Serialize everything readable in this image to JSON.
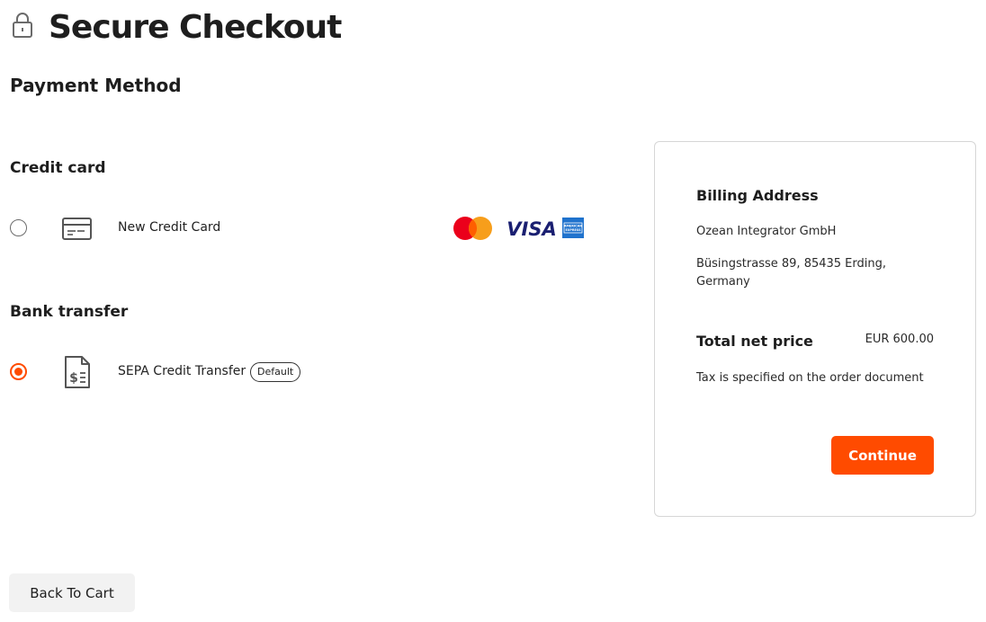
{
  "header": {
    "title": "Secure Checkout",
    "icon": "lock-icon"
  },
  "payment": {
    "section_title": "Payment Method",
    "credit_card": {
      "group_title": "Credit card",
      "option_label": "New Credit Card",
      "selected": false,
      "icon": "credit-card-icon",
      "brands": [
        "mastercard-logo",
        "visa-logo",
        "amex-logo"
      ],
      "visa_text": "VISA",
      "amex_text": "AMERICAN EXPRESS"
    },
    "bank_transfer": {
      "group_title": "Bank transfer",
      "option_label": "SEPA Credit Transfer",
      "badge": "Default",
      "selected": true,
      "icon": "invoice-document-icon"
    }
  },
  "summary": {
    "billing_title": "Billing Address",
    "company": "Ozean Integrator GmbH",
    "address": "Büsingstrasse 89, 85435 Erding, Germany",
    "total_label": "Total net price",
    "total_value": "EUR 600.00",
    "tax_note": "Tax is specified on the order document",
    "continue_label": "Continue"
  },
  "footer": {
    "back_label": "Back To Cart"
  },
  "colors": {
    "accent": "#ff4b00",
    "text": "#1e1e1e",
    "border": "#d6d6d6",
    "secondary_button": "#f2f2f2"
  }
}
